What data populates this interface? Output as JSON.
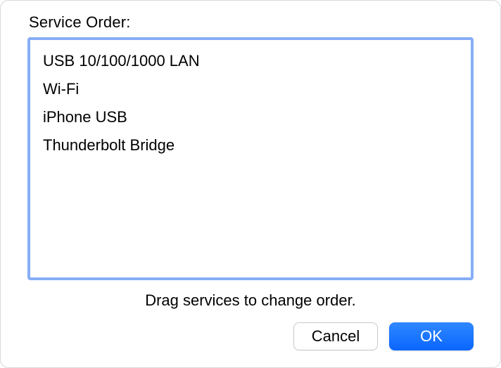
{
  "title": "Service Order:",
  "services": [
    "USB 10/100/1000 LAN",
    "Wi-Fi",
    "iPhone USB",
    "Thunderbolt Bridge"
  ],
  "hint": "Drag services to change order.",
  "buttons": {
    "cancel": "Cancel",
    "ok": "OK"
  }
}
